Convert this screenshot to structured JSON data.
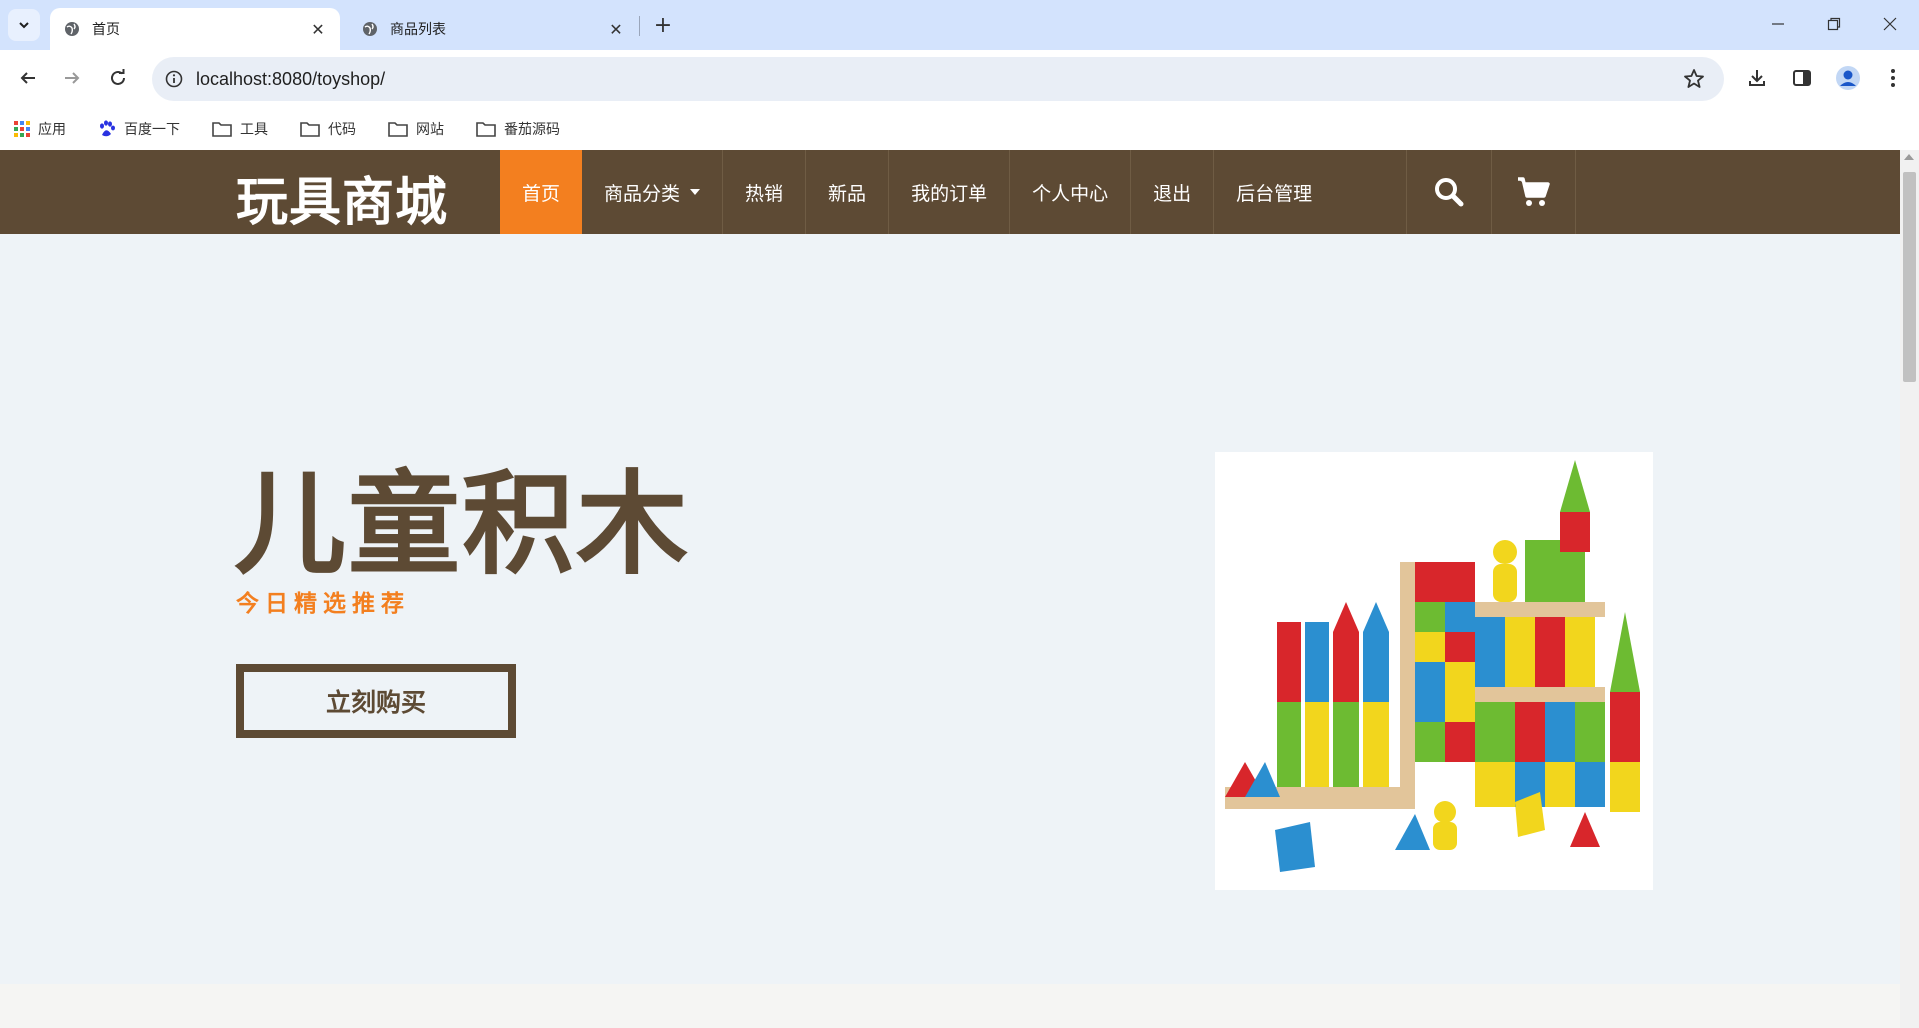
{
  "browser": {
    "tabs": [
      {
        "label": "首页",
        "active": true
      },
      {
        "label": "商品列表",
        "active": false
      }
    ],
    "url": "localhost:8080/toyshop/",
    "bookmarks": [
      {
        "label": "应用",
        "icon": "apps-grid-icon"
      },
      {
        "label": "百度一下",
        "icon": "baidu-paw-icon"
      },
      {
        "label": "工具",
        "icon": "folder-icon"
      },
      {
        "label": "代码",
        "icon": "folder-icon"
      },
      {
        "label": "网站",
        "icon": "folder-icon"
      },
      {
        "label": "番茄源码",
        "icon": "folder-icon"
      }
    ]
  },
  "site": {
    "logo": "玩具商城",
    "nav": [
      {
        "label": "首页",
        "active": true
      },
      {
        "label": "商品分类",
        "dropdown": true
      },
      {
        "label": "热销"
      },
      {
        "label": "新品"
      },
      {
        "label": "我的订单"
      },
      {
        "label": "个人中心"
      },
      {
        "label": "退出"
      },
      {
        "label": "后台管理"
      }
    ],
    "colors": {
      "header": "#5d4a34",
      "accent": "#f37f1f",
      "hero_bg": "#eef3f7"
    }
  },
  "hero": {
    "title": "儿童积木",
    "subtitle": "今日精选推荐",
    "button": "立刻购买"
  }
}
